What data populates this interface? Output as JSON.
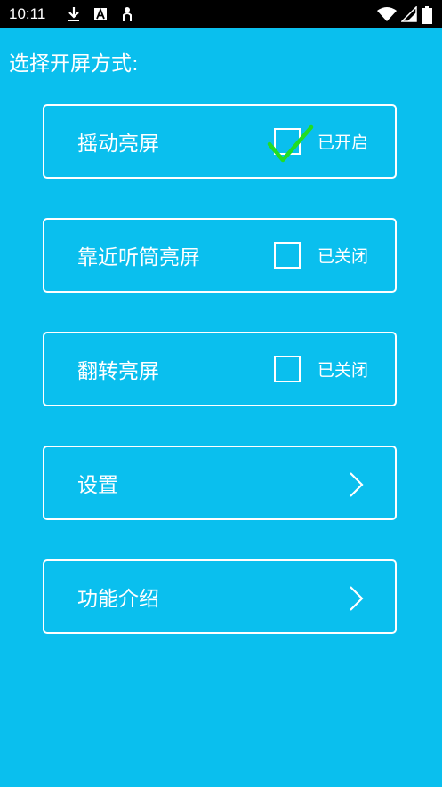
{
  "status_bar": {
    "time": "10:11",
    "icons": [
      "download-icon",
      "text-a-icon",
      "accessibility-icon",
      "wifi-icon",
      "signal-icon",
      "battery-icon"
    ]
  },
  "page": {
    "title": "选择开屏方式:"
  },
  "options": [
    {
      "label": "摇动亮屏",
      "state": "已开启",
      "checked": true
    },
    {
      "label": "靠近听筒亮屏",
      "state": "已关闭",
      "checked": false
    },
    {
      "label": "翻转亮屏",
      "state": "已关闭",
      "checked": false
    }
  ],
  "nav_items": [
    {
      "label": "设置",
      "icon": "chevron-right-icon"
    },
    {
      "label": "功能介绍",
      "icon": "chevron-right-icon"
    }
  ],
  "colors": {
    "background": "#0ABFEE",
    "border": "#FFFFFF",
    "check": "#22DD22",
    "status_bar": "#000000"
  }
}
